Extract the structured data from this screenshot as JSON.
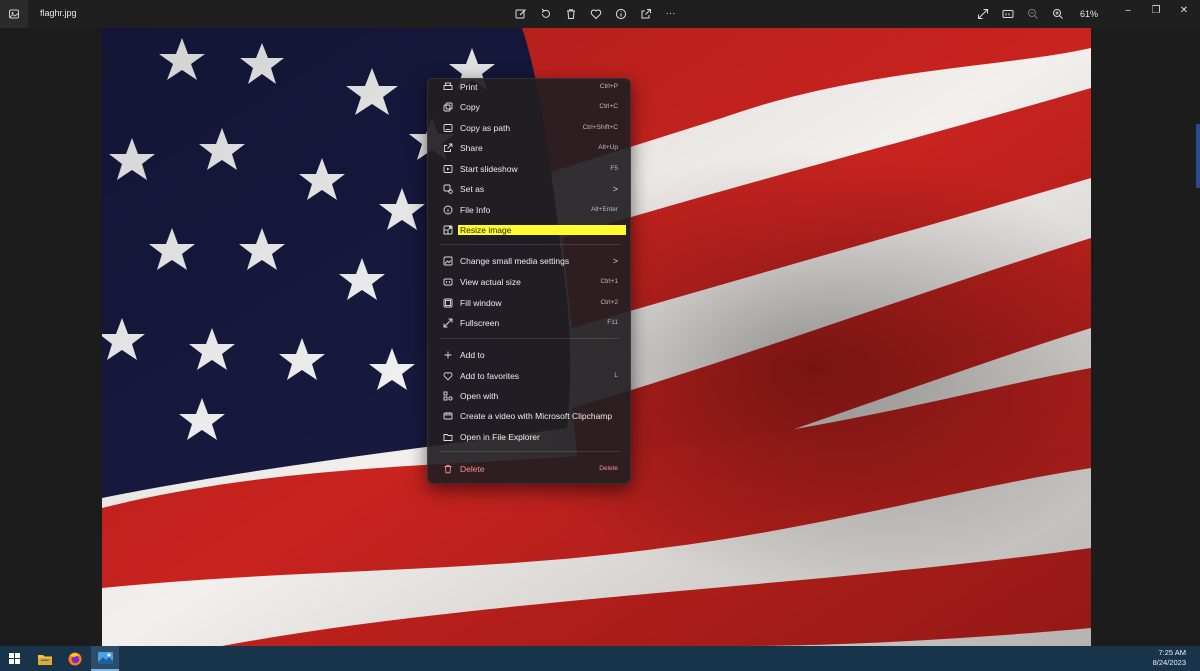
{
  "window": {
    "filename": "flaghr.jpg",
    "zoom": "61%"
  },
  "toolbar": {
    "icons": [
      "edit-icon",
      "rotate-icon",
      "delete-icon",
      "favorite-icon",
      "info-icon",
      "share-icon",
      "more-icon"
    ],
    "more_label": "···"
  },
  "window_controls": {
    "minimize": "–",
    "restore": "❐",
    "close": "✕"
  },
  "menu": {
    "items": [
      {
        "label": "Print",
        "shortcut": "Ctrl+P",
        "icon": "print-icon"
      },
      {
        "label": "Copy",
        "shortcut": "Ctrl+C",
        "icon": "copy-icon"
      },
      {
        "label": "Copy as path",
        "shortcut": "Ctrl+Shift+C",
        "icon": "copy-path-icon"
      },
      {
        "label": "Share",
        "shortcut": "Alt+Up",
        "icon": "share-icon"
      },
      {
        "label": "Start slideshow",
        "shortcut": "F5",
        "icon": "slideshow-icon"
      },
      {
        "label": "Set as",
        "shortcut": ">",
        "icon": "set-as-icon"
      },
      {
        "label": "File Info",
        "shortcut": "Alt+Enter",
        "icon": "info-icon"
      },
      {
        "label": "Resize image",
        "shortcut": "",
        "icon": "resize-icon"
      },
      {
        "label": "Change small media settings",
        "shortcut": ">",
        "icon": "media-settings-icon"
      },
      {
        "label": "View actual size",
        "shortcut": "Ctrl+1",
        "icon": "actual-size-icon"
      },
      {
        "label": "Fill window",
        "shortcut": "Ctrl+2",
        "icon": "fill-window-icon"
      },
      {
        "label": "Fullscreen",
        "shortcut": "F11",
        "icon": "fullscreen-icon"
      },
      {
        "label": "Add to",
        "shortcut": "",
        "icon": "add-icon"
      },
      {
        "label": "Add to favorites",
        "shortcut": "L",
        "icon": "heart-icon"
      },
      {
        "label": "Open with",
        "shortcut": "",
        "icon": "open-with-icon"
      },
      {
        "label": "Create a video with Microsoft Clipchamp",
        "shortcut": "",
        "icon": "clipchamp-icon"
      },
      {
        "label": "Open in File Explorer",
        "shortcut": "",
        "icon": "folder-icon"
      },
      {
        "label": "Delete",
        "shortcut": "Delete",
        "icon": "trash-icon"
      }
    ]
  },
  "taskbar": {
    "time": "7:25 AM",
    "date": "8/24/2023"
  }
}
